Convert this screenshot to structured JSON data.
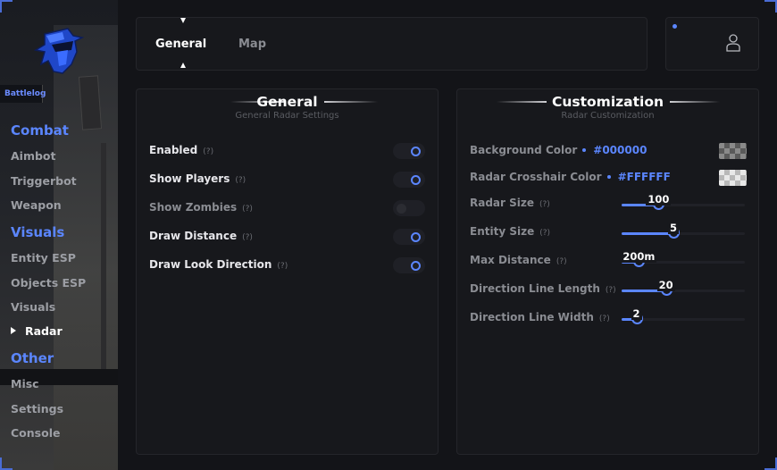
{
  "brand": {
    "name": "Battlelog"
  },
  "sidebar": {
    "sections": [
      {
        "title": "Combat",
        "items": [
          "Aimbot",
          "Triggerbot",
          "Weapon"
        ]
      },
      {
        "title": "Visuals",
        "items": [
          "Entity ESP",
          "Objects ESP",
          "Visuals",
          "Radar"
        ]
      },
      {
        "title": "Other",
        "items": [
          "Misc",
          "Settings",
          "Console"
        ]
      }
    ],
    "active_item": "Radar"
  },
  "tabs": [
    {
      "label": "General",
      "active": true
    },
    {
      "label": "Map",
      "active": false
    }
  ],
  "general_panel": {
    "title": "General",
    "subtitle": "General Radar Settings",
    "help": "(?)",
    "options": [
      {
        "label": "Enabled",
        "on": true
      },
      {
        "label": "Show Players",
        "on": true
      },
      {
        "label": "Show Zombies",
        "on": false
      },
      {
        "label": "Draw Distance",
        "on": true
      },
      {
        "label": "Draw Look Direction",
        "on": true
      }
    ]
  },
  "custom_panel": {
    "title": "Customization",
    "subtitle": "Radar Customization",
    "colors": [
      {
        "label": "Background Color",
        "hex": "#000000"
      },
      {
        "label": "Radar Crosshair Color",
        "hex": "#FFFFFF"
      }
    ],
    "sliders": [
      {
        "label": "Radar Size",
        "value": "100",
        "fraction": 0.3
      },
      {
        "label": "Entity Size",
        "value": "5",
        "fraction": 0.42
      },
      {
        "label": "Max Distance",
        "value": "200m",
        "fraction": 0.14
      },
      {
        "label": "Direction Line Length",
        "value": "20",
        "fraction": 0.36
      },
      {
        "label": "Direction Line Width",
        "value": "2",
        "fraction": 0.12
      }
    ]
  },
  "colors": {
    "accent": "#5b86ff",
    "background": "#131418",
    "panel": "#17181c"
  },
  "icons": {
    "logo": "hooded-knight-logo",
    "user": "user-icon",
    "active_nav": "triangle-right-icon"
  }
}
